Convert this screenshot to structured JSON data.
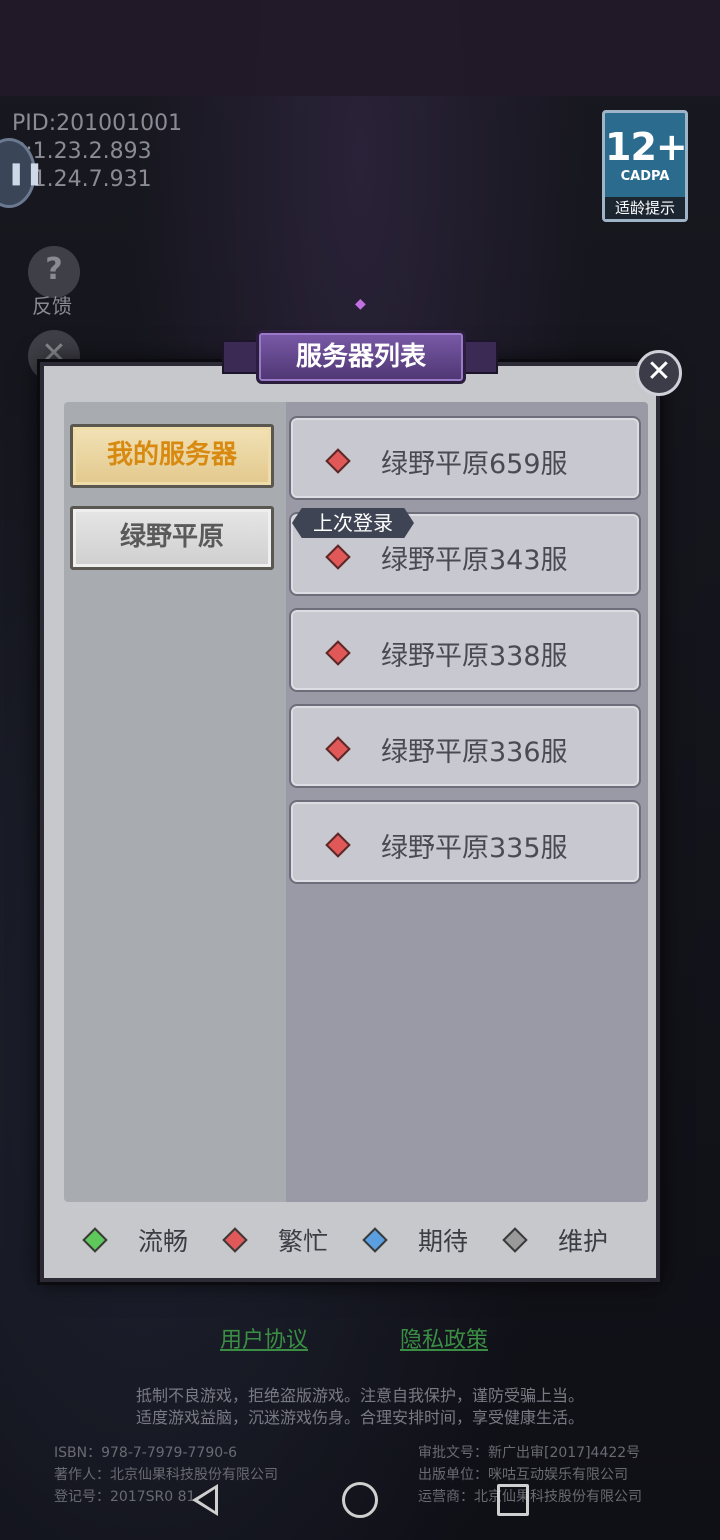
{
  "debug": {
    "pid": "PID:201001001",
    "line2": "P:1.23.2.893",
    "line3": "V:1.24.7.931"
  },
  "age_rating": {
    "age": "12+",
    "org": "CADPA",
    "tip": "适龄提示"
  },
  "side": {
    "feedback_label": "反馈",
    "feedback_icon": "question-icon",
    "tools_icon": "wrench-icon"
  },
  "dialog": {
    "title": "服务器列表",
    "close_icon": "close-icon",
    "categories": [
      {
        "label": "我的服务器",
        "selected": true
      },
      {
        "label": "绿野平原",
        "selected": false
      }
    ],
    "last_login_tag": "上次登录",
    "servers": [
      {
        "name": "绿野平原659服",
        "status": "繁忙"
      },
      {
        "name": "绿野平原343服",
        "status": "繁忙"
      },
      {
        "name": "绿野平原338服",
        "status": "繁忙"
      },
      {
        "name": "绿野平原336服",
        "status": "繁忙"
      },
      {
        "name": "绿野平原335服",
        "status": "繁忙"
      }
    ],
    "legend": [
      {
        "label": "流畅",
        "color": "#5fc85a"
      },
      {
        "label": "繁忙",
        "color": "#e05858"
      },
      {
        "label": "期待",
        "color": "#5aa0e0"
      },
      {
        "label": "维护",
        "color": "#9a9a9a"
      }
    ]
  },
  "links": {
    "user_agreement": "用户协议",
    "privacy_policy": "隐私政策"
  },
  "notice": {
    "line1": "抵制不良游戏，拒绝盗版游戏。注意自我保护，谨防受骗上当。",
    "line2": "适度游戏益脑，沉迷游戏伤身。合理安排时间，享受健康生活。"
  },
  "legal": {
    "isbn": "ISBN：978-7-7979-7790-6",
    "author": "著作人：北京仙果科技股份有限公司",
    "reg": "登记号：2017SR0 81",
    "approval": "审批文号：新广出审[2017]4422号",
    "publisher": "出版单位：咪咕互动娱乐有限公司",
    "operator": "运营商：北京仙果科技股份有限公司"
  },
  "nav": {
    "back_icon": "back-triangle-icon",
    "home_icon": "home-circle-icon",
    "recent_icon": "recent-square-icon"
  }
}
